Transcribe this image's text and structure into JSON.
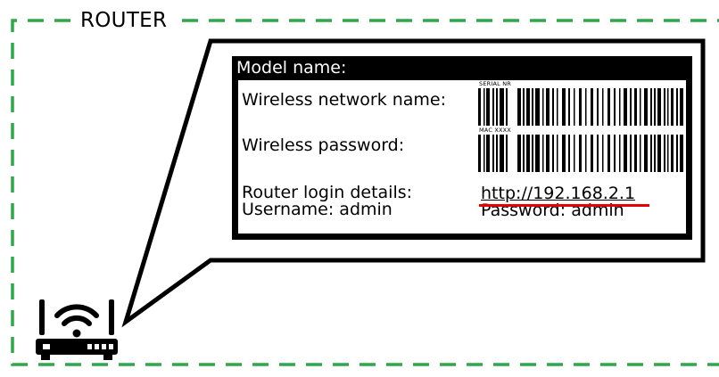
{
  "frame": {
    "title": "ROUTER",
    "border_color": "#2ea84a"
  },
  "label": {
    "header": "Model name:",
    "wireless_network_name": "Wireless network name:",
    "wireless_password": "Wireless password:",
    "router_login_details": "Router login details:",
    "username": "Username: admin",
    "password": "Password: admin",
    "login_url": "http://192.168.2.1",
    "serial_tag": "SERIAL NR",
    "mac_tag": "MAC XXXX",
    "highlight_color": "#e60000"
  },
  "icons": {
    "router": "router-wifi-icon"
  }
}
